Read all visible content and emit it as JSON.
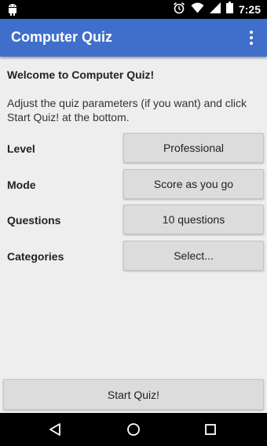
{
  "status_bar": {
    "time": "7:25",
    "icons": [
      "android-icon",
      "alarm-icon",
      "wifi-icon",
      "signal-icon",
      "battery-icon"
    ]
  },
  "app_bar": {
    "title": "Computer Quiz",
    "overflow_icon": "more-vert-icon",
    "color": "#3f6fca"
  },
  "main": {
    "welcome": "Welcome to Computer Quiz!",
    "intro": "Adjust the quiz parameters (if you want) and click Start Quiz! at the bottom.",
    "settings": [
      {
        "label": "Level",
        "value": "Professional"
      },
      {
        "label": "Mode",
        "value": "Score as you go"
      },
      {
        "label": "Questions",
        "value": "10 questions"
      },
      {
        "label": "Categories",
        "value": "Select..."
      }
    ],
    "start_button": "Start Quiz!"
  },
  "nav_bar": {
    "icons": [
      "back-icon",
      "home-icon",
      "recents-icon"
    ]
  }
}
